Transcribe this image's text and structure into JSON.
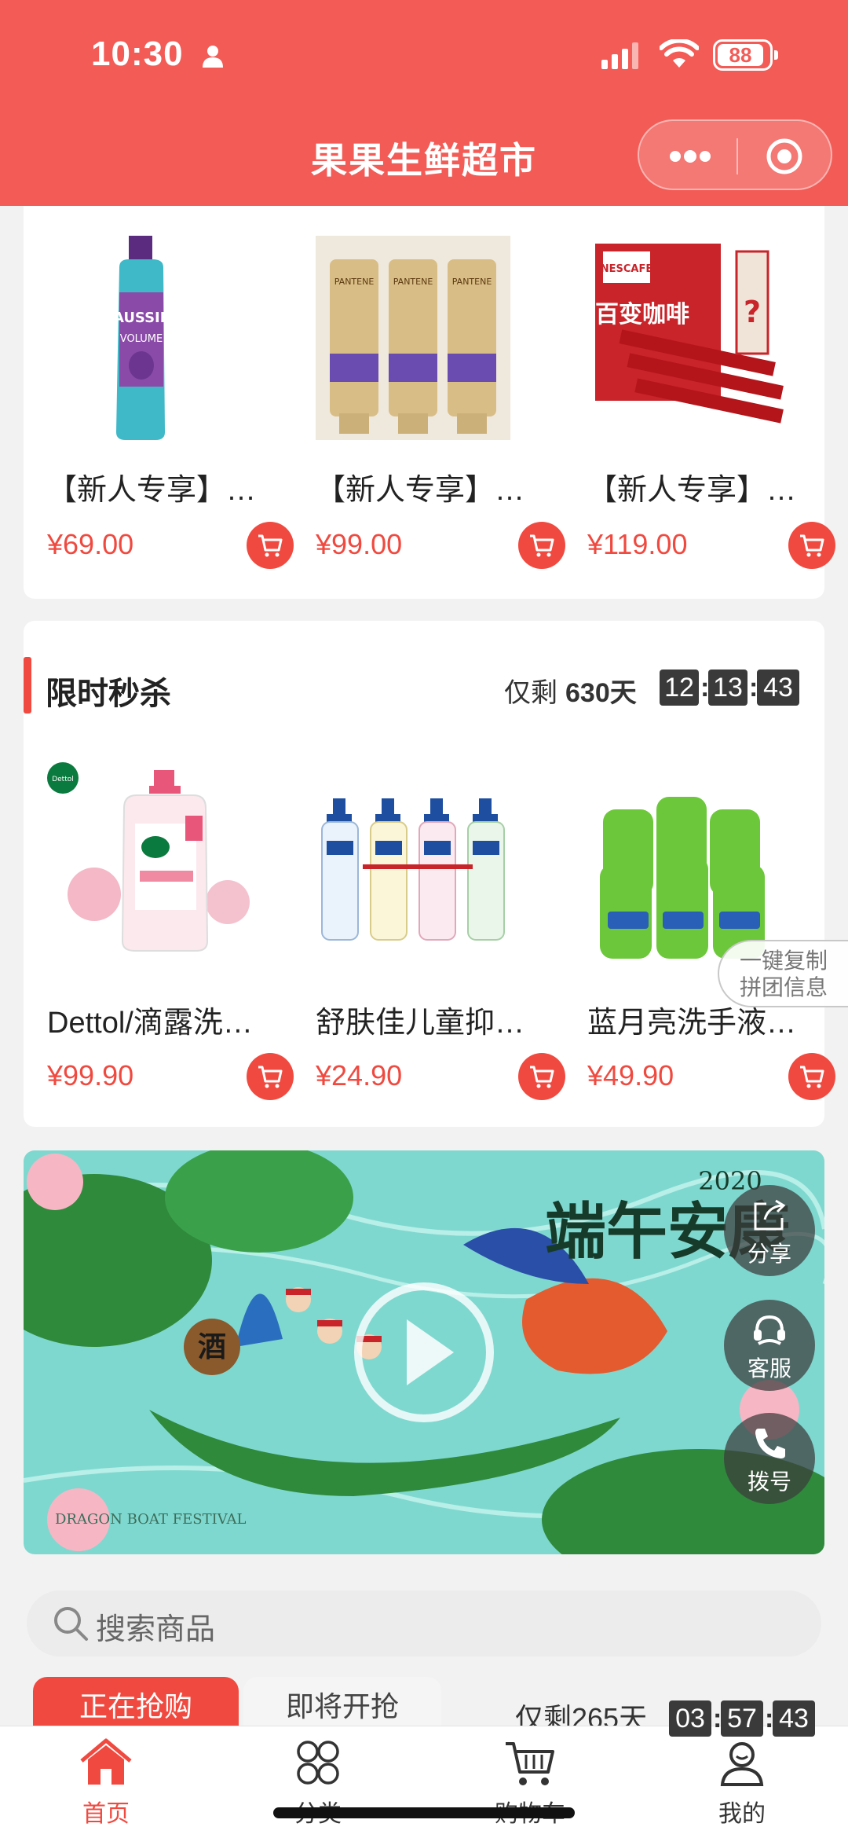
{
  "status_bar": {
    "time": "10:30",
    "battery": "88"
  },
  "header": {
    "title": "果果生鲜超市"
  },
  "new_user_products": [
    {
      "name": "【新人专享】Aussie洗发水",
      "price": "¥69.00"
    },
    {
      "name": "【新人专享】潘婷护发素",
      "price": "¥99.00"
    },
    {
      "name": "【新人专享】雀巢咖啡",
      "price": "¥119.00"
    }
  ],
  "flash_sale": {
    "title": "限时秒杀",
    "remaining_label": "仅剩",
    "days": "630天",
    "hours": "12",
    "minutes": "13",
    "seconds": "43",
    "products": [
      {
        "name": "Dettol/滴露洗手液",
        "price": "¥99.90"
      },
      {
        "name": "舒肤佳儿童抑菌洗手液",
        "price": "¥24.90"
      },
      {
        "name": "蓝月亮洗手液套装",
        "price": "¥49.90"
      }
    ]
  },
  "copy_tab": {
    "line1": "一键复制",
    "line2": "拼团信息"
  },
  "banner": {
    "headline": "端午安康",
    "year": "2020",
    "english": "DRAGON BOAT FESTIVAL",
    "jar_text": "酒"
  },
  "float_buttons": [
    {
      "label": "分享",
      "icon": "share-icon"
    },
    {
      "label": "客服",
      "icon": "headset-icon"
    },
    {
      "label": "拨号",
      "icon": "phone-icon"
    }
  ],
  "search": {
    "placeholder": "搜索商品"
  },
  "group_tabs": {
    "active": "正在抢购",
    "next": "即将开抢",
    "remaining": "仅剩265天",
    "hours": "03",
    "minutes": "57",
    "seconds": "43"
  },
  "bottom_nav": [
    {
      "label": "首页",
      "icon": "home-icon"
    },
    {
      "label": "分类",
      "icon": "category-icon"
    },
    {
      "label": "购物车",
      "icon": "cart-icon"
    },
    {
      "label": "我的",
      "icon": "profile-icon"
    }
  ],
  "colors": {
    "brand": "#f25b56",
    "price": "#f04a40"
  }
}
